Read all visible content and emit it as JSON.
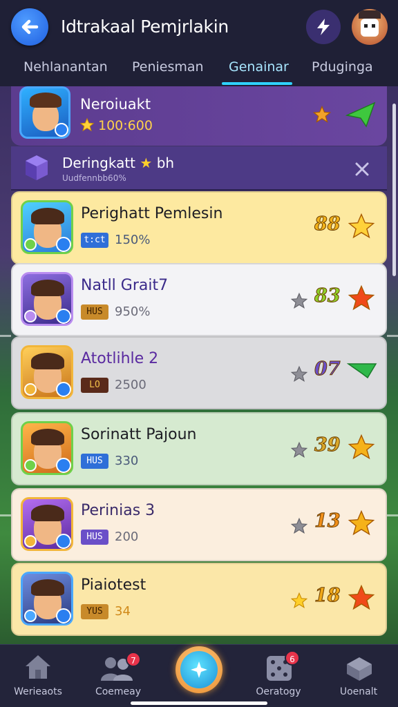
{
  "header": {
    "title": "Idtrakaal Pemjrlakin"
  },
  "tabs": [
    {
      "label": "Nehlanantan"
    },
    {
      "label": "Peniesman"
    },
    {
      "label": "Genainar"
    },
    {
      "label": "Pduginga"
    }
  ],
  "profile": {
    "name": "Neroiuakt",
    "points": "100:600"
  },
  "popup": {
    "title": "Deringkatt",
    "title_suffix": "bh",
    "subtitle": "Uudfennbb60%"
  },
  "rows": [
    {
      "name": "Perighatt Pemlesin",
      "tag": "t:ct",
      "value": "150%",
      "rank": "88",
      "bg": "#fde9a0",
      "rank_color": "#f2b21a"
    },
    {
      "name": "Natll Grait7",
      "tag": "HUS",
      "value": "950%",
      "rank": "83",
      "bg": "#f3f3f6",
      "rank_color": "#8fd02a"
    },
    {
      "name": "Atotlihle 2",
      "tag": "LO",
      "value": "2500",
      "rank": "07",
      "bg": "#dcdcdf",
      "rank_color": "#6b4fc8"
    },
    {
      "name": "Sorinatt Pajoun",
      "tag": "HUS",
      "value": "330",
      "rank": "39",
      "bg": "#d6ead0",
      "rank_color": "#d9a82a"
    },
    {
      "name": "Perinias 3",
      "tag": "HUS",
      "value": "200",
      "rank": "13",
      "bg": "#fbeede",
      "rank_color": "#f08f1a"
    },
    {
      "name": "Piaiotest",
      "tag": "YUS",
      "value": "34",
      "rank": "18",
      "bg": "#fbe7a8",
      "rank_color": "#f0a81a"
    }
  ],
  "bottom_nav": [
    {
      "label": "Werieaots",
      "icon": "house-icon"
    },
    {
      "label": "Coemeay",
      "icon": "users-icon",
      "badge": "7"
    },
    {
      "label": "Oeratogy",
      "icon": "dice-icon",
      "badge": "6"
    },
    {
      "label": "Uoenalt",
      "icon": "card-stack-icon"
    }
  ],
  "colors": {
    "accent": "#2fd2ff",
    "header_bg": "#1f2036",
    "nav_badge": "#e8334a"
  }
}
